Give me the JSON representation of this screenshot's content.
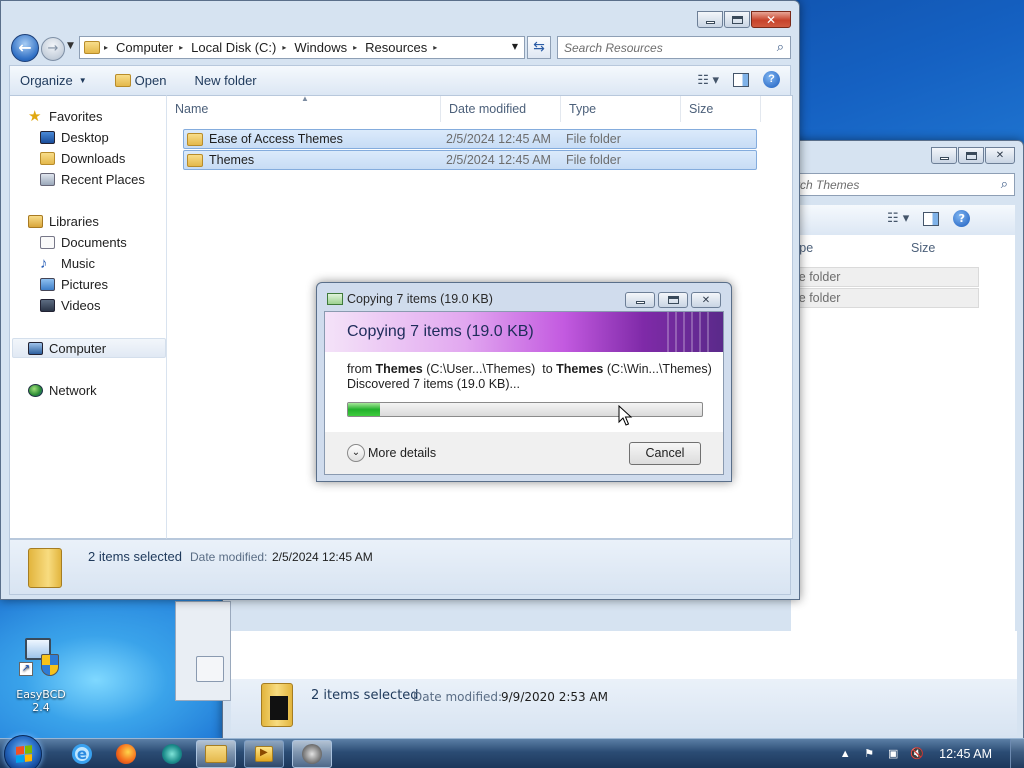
{
  "desktop": {
    "icons": [
      {
        "label": "EasyBCD 2.4",
        "icon": "easybcd-icon"
      }
    ]
  },
  "explorer_main": {
    "address": [
      "Computer",
      "Local Disk (C:)",
      "Windows",
      "Resources"
    ],
    "search_placeholder": "Search Resources",
    "toolbar": {
      "organize": "Organize",
      "open": "Open",
      "new_folder": "New folder"
    },
    "nav": {
      "favorites": "Favorites",
      "desktop": "Desktop",
      "downloads": "Downloads",
      "recent_places": "Recent Places",
      "libraries": "Libraries",
      "documents": "Documents",
      "music": "Music",
      "pictures": "Pictures",
      "videos": "Videos",
      "computer": "Computer",
      "network": "Network"
    },
    "columns": {
      "name": "Name",
      "date_modified": "Date modified",
      "type": "Type",
      "size": "Size"
    },
    "files": [
      {
        "name": "Ease of Access Themes",
        "date": "2/5/2024 12:45 AM",
        "type": "File folder"
      },
      {
        "name": "Themes",
        "date": "2/5/2024 12:45 AM",
        "type": "File folder"
      }
    ],
    "details": {
      "selection": "2 items selected",
      "date_label": "Date modified:",
      "date_value": "2/5/2024 12:45 AM"
    }
  },
  "explorer_back": {
    "search_placeholder": "rch Themes",
    "columns": {
      "type": "ype",
      "size": "Size"
    },
    "rows": [
      "le folder",
      "le folder"
    ],
    "details": {
      "selection": "2 items selected",
      "date_label": "Date modified:",
      "date_value": "9/9/2020 2:53 AM"
    }
  },
  "copy_dialog": {
    "title": "Copying 7 items (19.0 KB)",
    "heading": "Copying 7 items (19.0 KB)",
    "from_label": "from",
    "from_name": "Themes",
    "from_path": "(C:\\User...\\Themes)",
    "to_label": "to",
    "to_name": "Themes",
    "to_path": "(C:\\Win...\\Themes)",
    "status": "Discovered 7 items (19.0 KB)...",
    "progress": 0.09,
    "more_details": "More details",
    "cancel": "Cancel"
  },
  "taskbar": {
    "apps": [
      "internet-explorer-icon",
      "firefox-icon",
      "windows-media-center-icon",
      "windows-explorer-icon",
      "media-player-icon",
      "hard-disk-icon"
    ],
    "clock": "12:45 AM"
  }
}
